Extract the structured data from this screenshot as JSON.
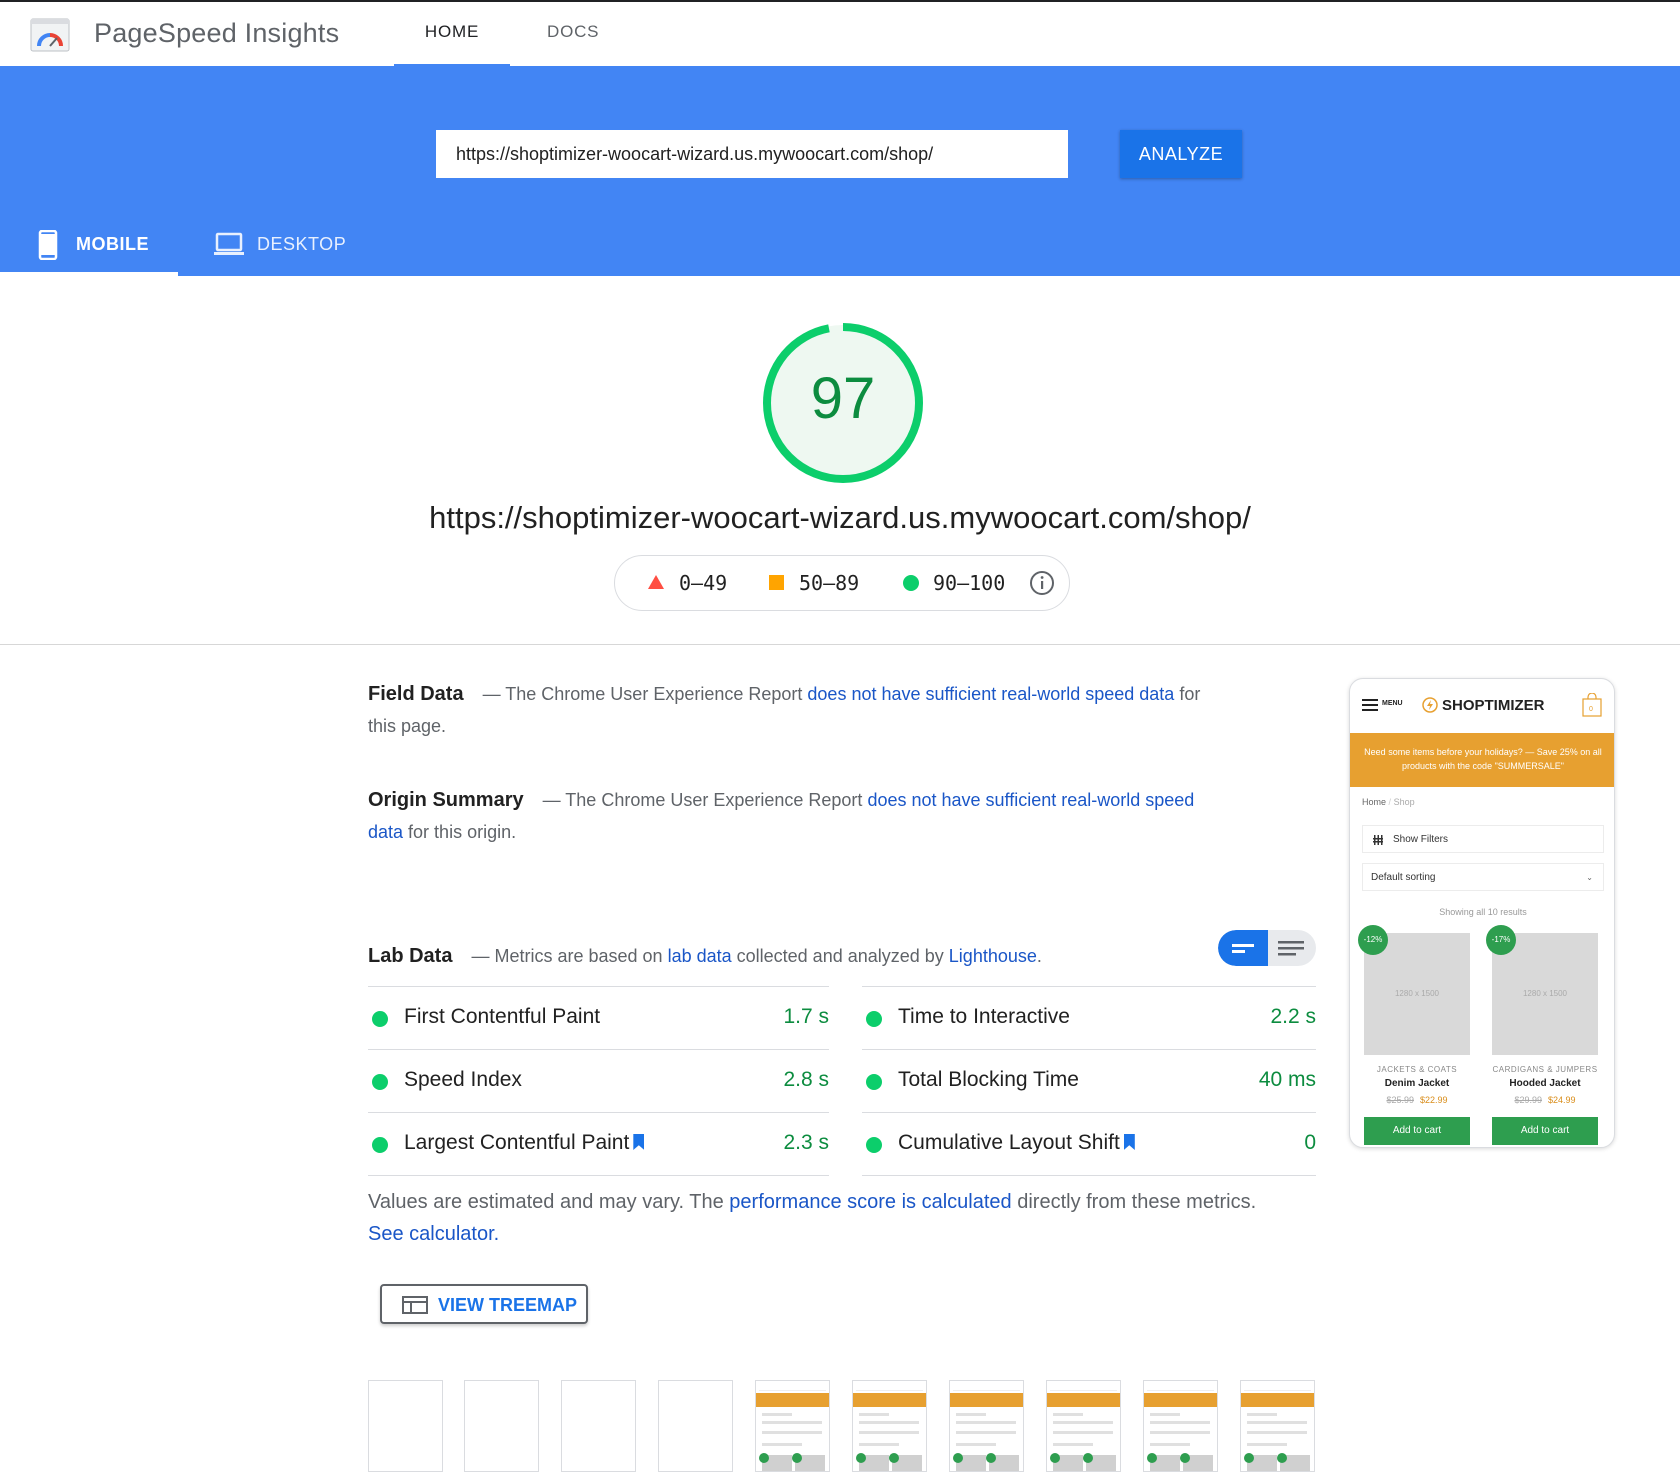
{
  "app": {
    "title": "PageSpeed Insights"
  },
  "nav": {
    "home": "HOME",
    "docs": "DOCS"
  },
  "search": {
    "url_value": "https://shoptimizer-woocart-wizard.us.mywoocart.com/shop/",
    "analyze_label": "ANALYZE"
  },
  "device_tabs": {
    "mobile": "MOBILE",
    "desktop": "DESKTOP",
    "selected": "MOBILE"
  },
  "score": {
    "value": "97",
    "fraction": 0.97,
    "color": "#0cce6b",
    "url": "https://shoptimizer-woocart-wizard.us.mywoocart.com/shop/"
  },
  "legend": {
    "fail": "0–49",
    "average": "50–89",
    "pass": "90–100"
  },
  "colors": {
    "fail": "#ff4e42",
    "average": "#ffa400",
    "pass": "#0cce6b",
    "brand": "#4285f4",
    "link": "#1a56c7"
  },
  "field_data": {
    "title": "Field Data",
    "text_before": "— The Chrome User Experience Report ",
    "link": "does not have sufficient real-world speed data",
    "text_after": " for this page."
  },
  "origin_summary": {
    "title": "Origin Summary",
    "text_before": "— The Chrome User Experience Report ",
    "link": "does not have sufficient real-world speed data",
    "text_after": " for this origin."
  },
  "lab_data": {
    "title": "Lab Data",
    "text_before": "— Metrics are based on ",
    "link1": "lab data",
    "text_middle": " collected and analyzed by ",
    "link2": "Lighthouse",
    "text_after": "."
  },
  "metrics": {
    "left": [
      {
        "name": "First Contentful Paint",
        "value": "1.7 s"
      },
      {
        "name": "Speed Index",
        "value": "2.8 s"
      },
      {
        "name": "Largest Contentful Paint",
        "value": "2.3 s"
      }
    ],
    "right": [
      {
        "name": "Time to Interactive",
        "value": "2.2 s"
      },
      {
        "name": "Total Blocking Time",
        "value": "40 ms"
      },
      {
        "name": "Cumulative Layout Shift",
        "value": "0"
      }
    ]
  },
  "note": {
    "text_before": "Values are estimated and may vary. The ",
    "link1": "performance score is calculated",
    "text_middle": " directly from these metrics. ",
    "link2": "See calculator."
  },
  "treemap": {
    "label": "VIEW TREEMAP"
  },
  "preview": {
    "menu": "MENU",
    "brand": "SHOPTIMIZER",
    "cart_count": "0",
    "banner": "Need some items before your holidays? — Save 25% on all products with the code \"SUMMERSALE\"",
    "crumb_home": "Home",
    "crumb_sep": "/",
    "crumb_shop": "Shop",
    "filters": "Show Filters",
    "sorting": "Default sorting",
    "results": "Showing all 10 results",
    "products": [
      {
        "badge": "-12%",
        "img_label": "1280 x 1500",
        "category": "JACKETS & COATS",
        "name": "Denim Jacket",
        "old_price": "$25.99",
        "price": "$22.99",
        "button": "Add to cart"
      },
      {
        "badge": "-17%",
        "img_label": "1280 x 1500",
        "category": "CARDIGANS & JUMPERS",
        "name": "Hooded Jacket",
        "old_price": "$29.99",
        "price": "$24.99",
        "button": "Add to cart"
      }
    ]
  }
}
